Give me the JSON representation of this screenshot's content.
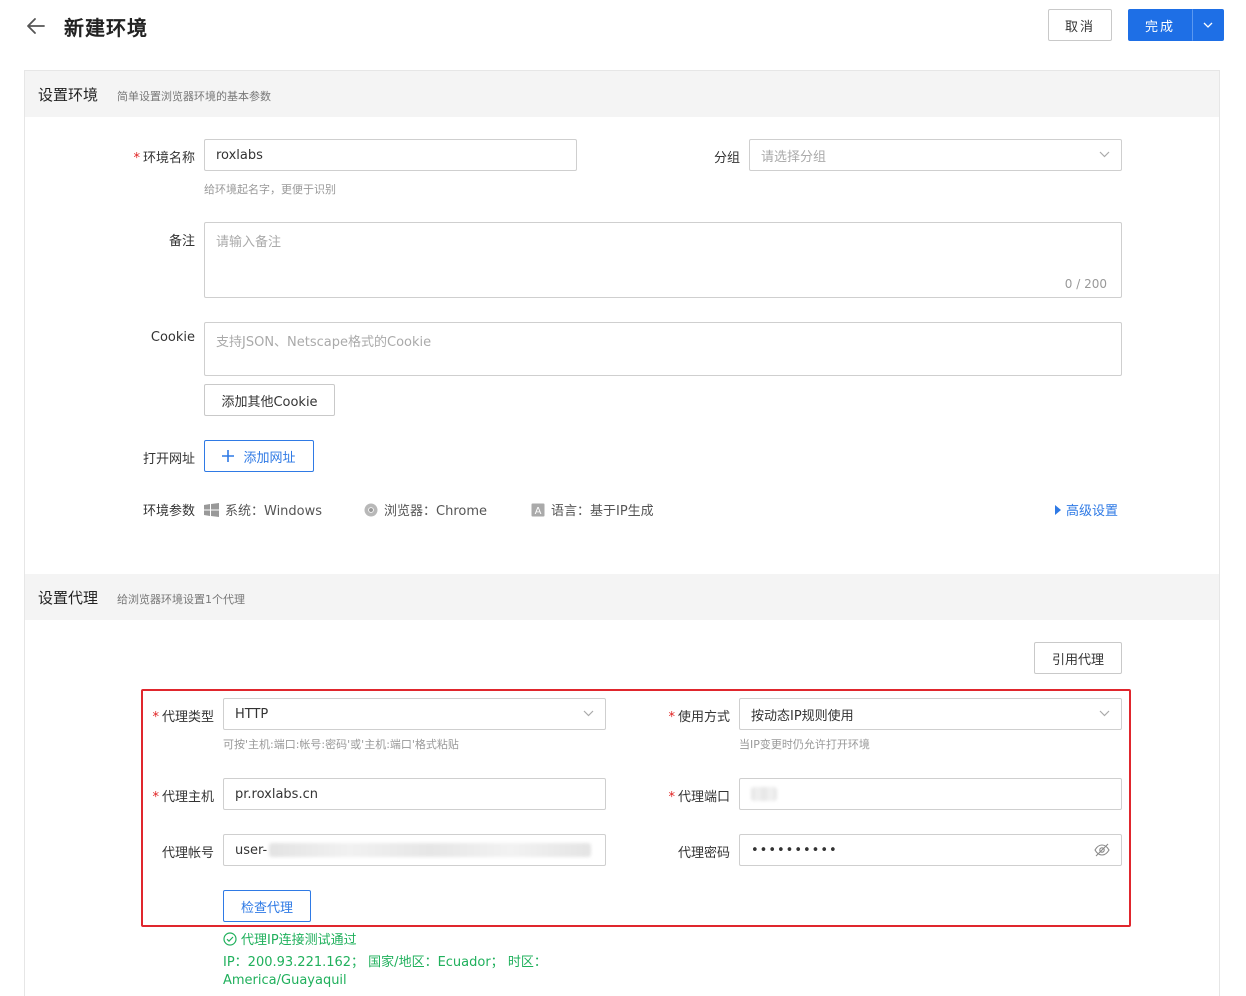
{
  "header": {
    "title": "新建环境",
    "cancel_label": "取消",
    "finish_label": "完成"
  },
  "env_section": {
    "title": "设置环境",
    "subtitle": "简单设置浏览器环境的基本参数",
    "name_label": "环境名称",
    "name_value": "roxlabs",
    "name_hint": "给环境起名字，更便于识别",
    "group_label": "分组",
    "group_placeholder": "请选择分组",
    "note_label": "备注",
    "note_placeholder": "请输入备注",
    "note_counter": "0 / 200",
    "cookie_label": "Cookie",
    "cookie_placeholder": "支持JSON、Netscape格式的Cookie",
    "add_cookie_label": "添加其他Cookie",
    "open_url_label": "打开网址",
    "add_url_label": "添加网址",
    "params_label": "环境参数",
    "system_text": "系统：Windows",
    "browser_text": "浏览器：Chrome",
    "language_text": "语言：基于IP生成",
    "advanced_label": "高级设置"
  },
  "proxy_section": {
    "title": "设置代理",
    "subtitle": "给浏览器环境设置1个代理",
    "ref_proxy_label": "引用代理",
    "type_label": "代理类型",
    "type_value": "HTTP",
    "type_hint": "可按'主机:端口:帐号:密码'或'主机:端口'格式粘贴",
    "usage_label": "使用方式",
    "usage_value": "按动态IP规则使用",
    "usage_hint": "当IP变更时仍允许打开环境",
    "host_label": "代理主机",
    "host_value": "pr.roxlabs.cn",
    "port_label": "代理端口",
    "account_label": "代理帐号",
    "account_value": "user-",
    "password_label": "代理密码",
    "password_value": "••••••••••",
    "check_label": "检查代理",
    "success_text": "代理IP连接测试通过",
    "result_line1": "IP：200.93.221.162； 国家/地区：Ecuador； 时区：",
    "result_line2": "America/Guayaquil"
  },
  "colors": {
    "primary": "#1e6fe6",
    "required": "#e02020",
    "success": "#20b05c",
    "highlight_border": "#e0262d"
  }
}
